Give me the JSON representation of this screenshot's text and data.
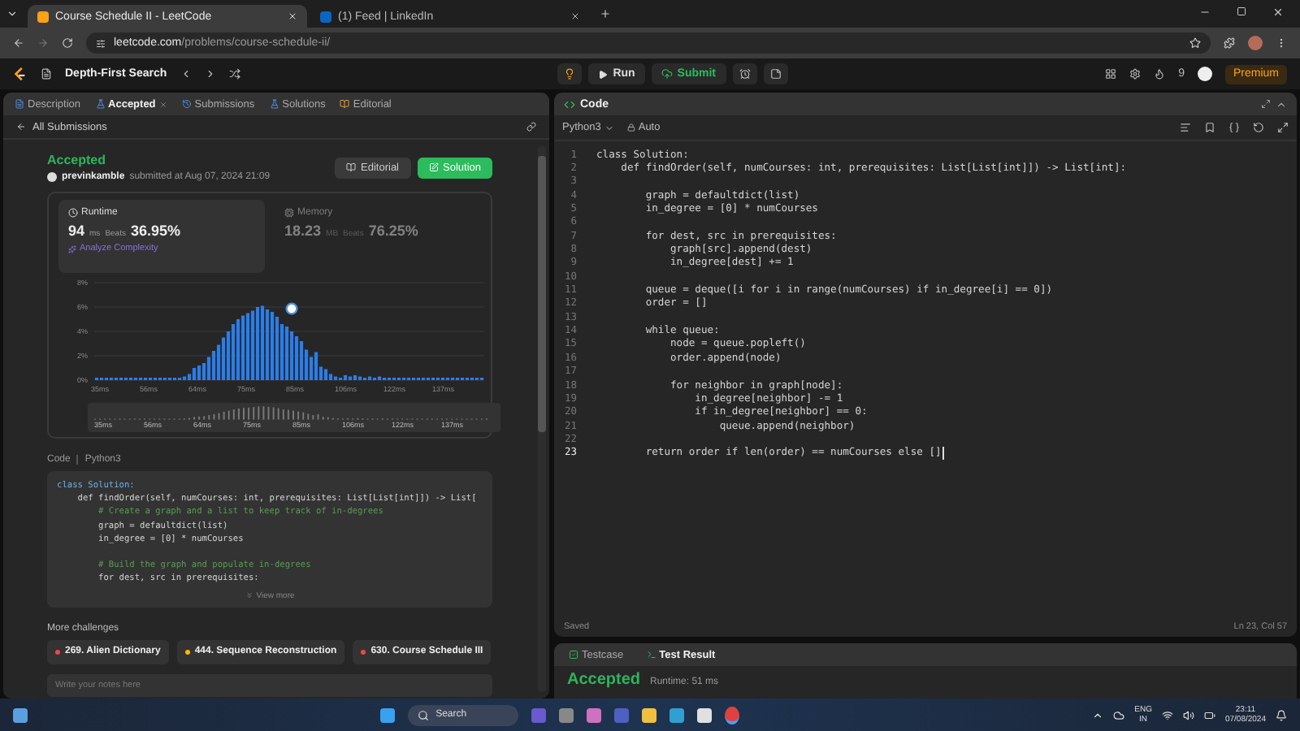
{
  "browser": {
    "tabs": [
      {
        "title": "Course Schedule II - LeetCode",
        "selected": true
      },
      {
        "title": "(1) Feed | LinkedIn",
        "selected": false
      }
    ],
    "url_host": "leetcode.com",
    "url_path": "/problems/course-schedule-ii/"
  },
  "topbar": {
    "problem_list": "Depth-First Search",
    "run": "Run",
    "submit": "Submit",
    "streak": "9",
    "premium": "Premium"
  },
  "left_tabs": [
    {
      "label": "Description",
      "selected": false
    },
    {
      "label": "Accepted",
      "selected": true
    },
    {
      "label": "Submissions",
      "selected": false
    },
    {
      "label": "Solutions",
      "selected": false
    },
    {
      "label": "Editorial",
      "selected": false
    }
  ],
  "back_link": "All Submissions",
  "submission": {
    "status": "Accepted",
    "user": "previnkamble",
    "submitted": "submitted at Aug 07, 2024 21:09",
    "editorial_button": "Editorial",
    "solution_button": "Solution"
  },
  "stats": [
    {
      "kind": "runtime",
      "label": "Runtime",
      "value": "94",
      "unit": "ms",
      "beats_label": "Beats",
      "beats": "36.95%",
      "selected": true
    },
    {
      "kind": "memory",
      "label": "Memory",
      "value": "18.23",
      "unit": "MB",
      "beats_label": "Beats",
      "beats": "76.25%",
      "selected": false
    }
  ],
  "analyze": "Analyze Complexity",
  "chart_data": {
    "type": "bar",
    "ylim": [
      0,
      8
    ],
    "yticks": [
      {
        "value": 0,
        "label": "0%"
      },
      {
        "value": 2,
        "label": "2%"
      },
      {
        "value": 4,
        "label": "4%"
      },
      {
        "value": 6,
        "label": "6%"
      },
      {
        "value": 8,
        "label": "8%"
      }
    ],
    "grid": true,
    "values": [
      0.2,
      0.2,
      0.2,
      0.2,
      0.2,
      0.2,
      0.2,
      0.2,
      0.2,
      0.2,
      0.2,
      0.2,
      0.2,
      0.2,
      0.2,
      0.2,
      0.2,
      0.2,
      0.3,
      0.5,
      1.0,
      1.2,
      1.4,
      1.9,
      2.4,
      2.9,
      3.5,
      4.0,
      4.6,
      5.0,
      5.3,
      5.5,
      5.7,
      6.0,
      6.1,
      5.8,
      5.6,
      5.2,
      4.6,
      4.4,
      4.0,
      3.6,
      3.2,
      2.5,
      1.9,
      2.3,
      1.1,
      0.9,
      0.5,
      0.3,
      0.2,
      0.4,
      0.3,
      0.4,
      0.3,
      0.2,
      0.3,
      0.2,
      0.3,
      0.2,
      0.2,
      0.2,
      0.2,
      0.2,
      0.2,
      0.2,
      0.2,
      0.2,
      0.2,
      0.2,
      0.2,
      0.2,
      0.2,
      0.2,
      0.2,
      0.2,
      0.2,
      0.2,
      0.2,
      0.2
    ]
  },
  "chart_xlabels": [
    "35ms",
    "56ms",
    "64ms",
    "75ms",
    "85ms",
    "106ms",
    "122ms",
    "137ms"
  ],
  "navigator_labels": [
    "35ms",
    "56ms",
    "64ms",
    "75ms",
    "85ms",
    "106ms",
    "122ms",
    "137ms"
  ],
  "code_header": {
    "label": "Code",
    "language": "Python3"
  },
  "snippet": [
    {
      "kind": "code",
      "text": "class Solution:"
    },
    {
      "kind": "code",
      "text": "    def findOrder(self, numCourses: int, prerequisites: List[List[int]]) -> List["
    },
    {
      "kind": "comment",
      "text": "        # Create a graph and a list to keep track of in-degrees"
    },
    {
      "kind": "code",
      "text": "        graph = defaultdict(list)"
    },
    {
      "kind": "code",
      "text": "        in_degree = [0] * numCourses"
    },
    {
      "kind": "blank"
    },
    {
      "kind": "comment",
      "text": "        # Build the graph and populate in-degrees"
    },
    {
      "kind": "code",
      "text": "        for dest, src in prerequisites:"
    }
  ],
  "view_more": "View more",
  "more_challenges": {
    "title": "More challenges",
    "items": [
      {
        "label": "269. Alien Dictionary",
        "color": "#ef4743"
      },
      {
        "label": "444. Sequence Reconstruction",
        "color": "#ffb800"
      },
      {
        "label": "630. Course Schedule III",
        "color": "#ef4743"
      }
    ]
  },
  "notes": {
    "placeholder": "Write your notes here"
  },
  "editor": {
    "title": "Code",
    "language": "Python3",
    "mode": "Auto",
    "status": "Saved",
    "cursor": "Ln 23, Col 57",
    "lines": [
      {
        "number": "1",
        "code": "class Solution:",
        "current": false
      },
      {
        "number": "2",
        "code": "    def findOrder(self, numCourses: int, prerequisites: List[List[int]]) -> List[int]:",
        "current": false
      },
      {
        "number": "3",
        "current": false
      },
      {
        "number": "4",
        "code": "        graph = defaultdict(list)",
        "current": false
      },
      {
        "number": "5",
        "code": "        in_degree = [0] * numCourses",
        "current": false
      },
      {
        "number": "6",
        "current": false
      },
      {
        "number": "7",
        "code": "        for dest, src in prerequisites:",
        "current": false
      },
      {
        "number": "8",
        "code": "            graph[src].append(dest)",
        "current": false
      },
      {
        "number": "9",
        "code": "            in_degree[dest] += 1",
        "current": false
      },
      {
        "number": "10",
        "current": false
      },
      {
        "number": "11",
        "code": "        queue = deque([i for i in range(numCourses) if in_degree[i] == 0])",
        "current": false
      },
      {
        "number": "12",
        "code": "        order = []",
        "current": false
      },
      {
        "number": "13",
        "current": false
      },
      {
        "number": "14",
        "code": "        while queue:",
        "current": false
      },
      {
        "number": "15",
        "code": "            node = queue.popleft()",
        "current": false
      },
      {
        "number": "16",
        "code": "            order.append(node)",
        "current": false
      },
      {
        "number": "17",
        "current": false
      },
      {
        "number": "18",
        "code": "            for neighbor in graph[node]:",
        "current": false
      },
      {
        "number": "19",
        "code": "                in_degree[neighbor] -= 1",
        "current": false
      },
      {
        "number": "20",
        "code": "                if in_degree[neighbor] == 0:",
        "current": false
      },
      {
        "number": "21",
        "code": "                    queue.append(neighbor)",
        "current": false
      },
      {
        "number": "22",
        "current": false
      },
      {
        "number": "23",
        "code": "        return order if len(order) == numCourses else []",
        "current": true
      }
    ]
  },
  "bottom_panel": {
    "tabs": [
      {
        "label": "Testcase",
        "selected": false
      },
      {
        "label": "Test Result",
        "selected": true
      }
    ],
    "result": "Accepted",
    "runtime": "Runtime: 51 ms"
  },
  "taskbar": {
    "search": "Search",
    "lang": "ENG",
    "region": "IN",
    "time": "23:11",
    "date": "07/08/2024"
  }
}
